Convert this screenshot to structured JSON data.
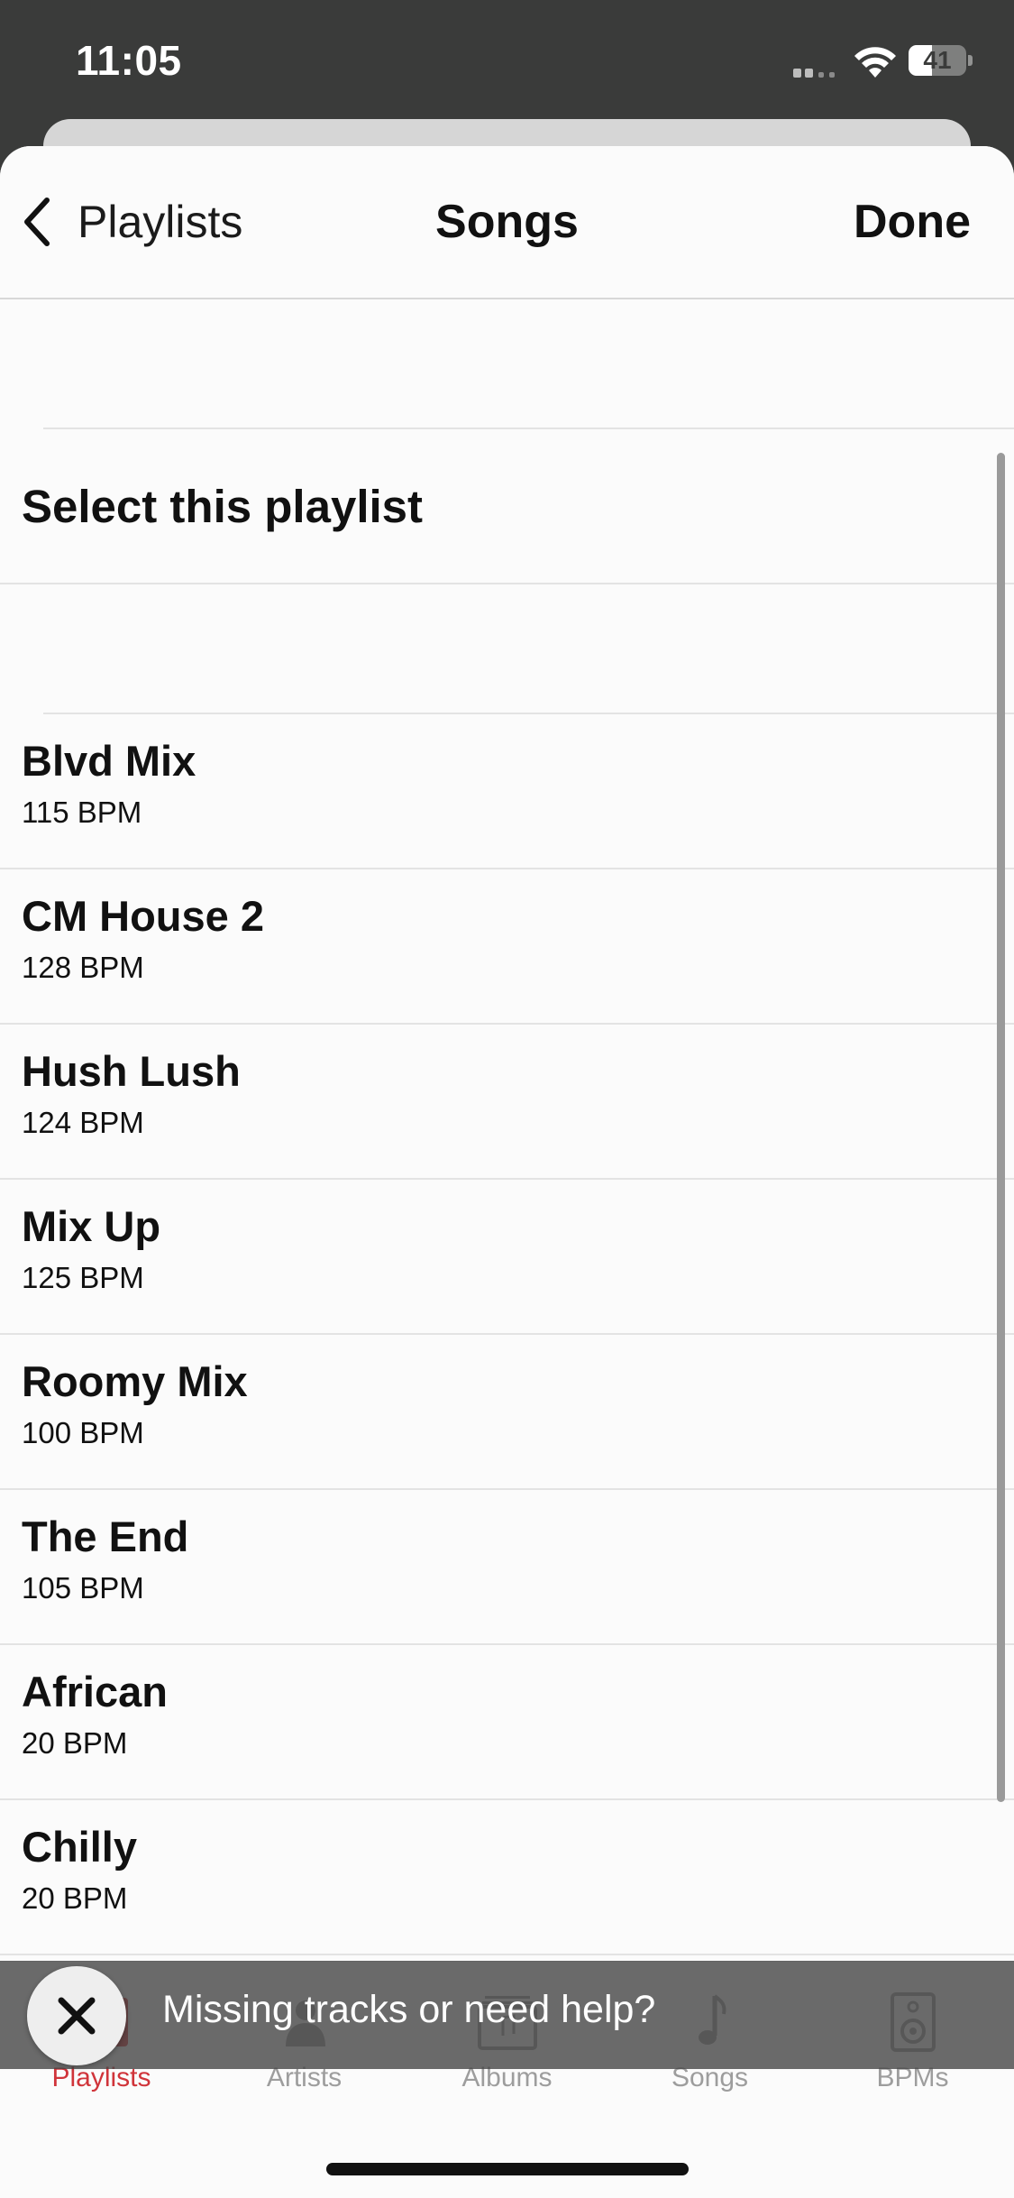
{
  "status_bar": {
    "time": "11:05",
    "battery": "41",
    "battery_fraction": 0.41
  },
  "nav": {
    "back_label": "Playlists",
    "title": "Songs",
    "done_label": "Done"
  },
  "select_label": "Select this playlist",
  "playlists": [
    {
      "name": "Blvd Mix",
      "bpm": "115 BPM"
    },
    {
      "name": "CM House 2",
      "bpm": "128 BPM"
    },
    {
      "name": "Hush Lush",
      "bpm": "124 BPM"
    },
    {
      "name": "Mix Up",
      "bpm": "125 BPM"
    },
    {
      "name": "Roomy Mix",
      "bpm": "100 BPM"
    },
    {
      "name": "The End",
      "bpm": "105 BPM"
    },
    {
      "name": "African",
      "bpm": "20 BPM"
    },
    {
      "name": "Chilly",
      "bpm": "20 BPM"
    }
  ],
  "banner": {
    "text": "Missing tracks or need help?",
    "icon": "close-icon"
  },
  "tabs": [
    {
      "label": "Playlists",
      "icon": "playlist-icon",
      "active": true
    },
    {
      "label": "Artists",
      "icon": "artist-icon",
      "active": false
    },
    {
      "label": "Albums",
      "icon": "album-icon",
      "active": false
    },
    {
      "label": "Songs",
      "icon": "music-note-icon",
      "active": false
    },
    {
      "label": "BPMs",
      "icon": "speaker-icon",
      "active": false
    }
  ],
  "colors": {
    "accent": "#d0343a",
    "inactive": "#9d9d9d"
  }
}
